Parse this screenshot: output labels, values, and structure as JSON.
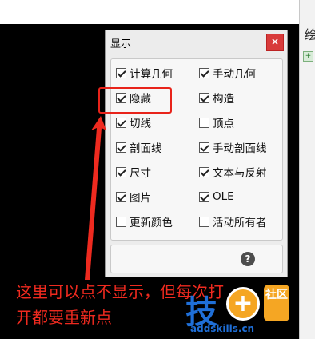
{
  "right_panel": {
    "partial_text": "绘"
  },
  "dialog": {
    "title": "显示",
    "close_symbol": "×",
    "help_symbol": "?",
    "options": [
      {
        "label": "计算几何",
        "checked": true
      },
      {
        "label": "手动几何",
        "checked": true
      },
      {
        "label": "隐藏",
        "checked": true
      },
      {
        "label": "构造",
        "checked": true
      },
      {
        "label": "切线",
        "checked": true
      },
      {
        "label": "顶点",
        "checked": false
      },
      {
        "label": "剖面线",
        "checked": true
      },
      {
        "label": "手动剖面线",
        "checked": true
      },
      {
        "label": "尺寸",
        "checked": true
      },
      {
        "label": "文本与反射",
        "checked": true
      },
      {
        "label": "图片",
        "checked": true
      },
      {
        "label": "OLE",
        "checked": true
      },
      {
        "label": "更新颜色",
        "checked": false
      },
      {
        "label": "活动所有者",
        "checked": false
      }
    ]
  },
  "annotation": {
    "line1": "这里可以点不显示，但每次打",
    "line2": "开都要重新点",
    "color": "#ee2a1f"
  },
  "watermark": {
    "logo_char": "技",
    "plus_symbol": "+",
    "badge_text": "社区",
    "url": "addskills.cn"
  }
}
